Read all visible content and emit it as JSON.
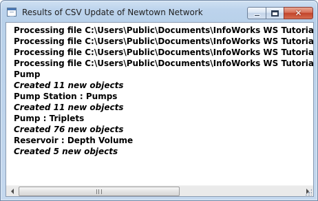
{
  "window": {
    "title": "Results of CSV Update of Newtown Network",
    "app_icon": "window-app-icon",
    "controls": {
      "minimize_icon": "minimize-icon",
      "maximize_icon": "maximize-icon",
      "close_icon": "close-icon",
      "close_glyph": "✕"
    }
  },
  "log": {
    "lines": [
      {
        "text": "Processing file C:\\Users\\Public\\Documents\\InfoWorks WS Tutorial",
        "italic": false
      },
      {
        "text": "Processing file C:\\Users\\Public\\Documents\\InfoWorks WS Tutorial",
        "italic": false
      },
      {
        "text": "Processing file C:\\Users\\Public\\Documents\\InfoWorks WS Tutorial",
        "italic": false
      },
      {
        "text": "Processing file C:\\Users\\Public\\Documents\\InfoWorks WS Tutorial",
        "italic": false
      },
      {
        "text": "Pump",
        "italic": false
      },
      {
        "text": "Created 11 new objects",
        "italic": true
      },
      {
        "text": "Pump Station : Pumps",
        "italic": false
      },
      {
        "text": "Created 11 new objects",
        "italic": true
      },
      {
        "text": "Pump : Triplets",
        "italic": false
      },
      {
        "text": "Created 76 new objects",
        "italic": true
      },
      {
        "text": "Reservoir : Depth Volume",
        "italic": false
      },
      {
        "text": "Created 5 new objects",
        "italic": true
      }
    ]
  },
  "scrollbar": {
    "left_arrow_icon": "scroll-left-icon",
    "right_arrow_icon": "scroll-right-icon",
    "thumb_fraction": 0.57,
    "position_fraction": 0.0
  },
  "colors": {
    "text": "#000000",
    "titlebar": "#bcd3ec",
    "close_button": "#c2432a"
  }
}
